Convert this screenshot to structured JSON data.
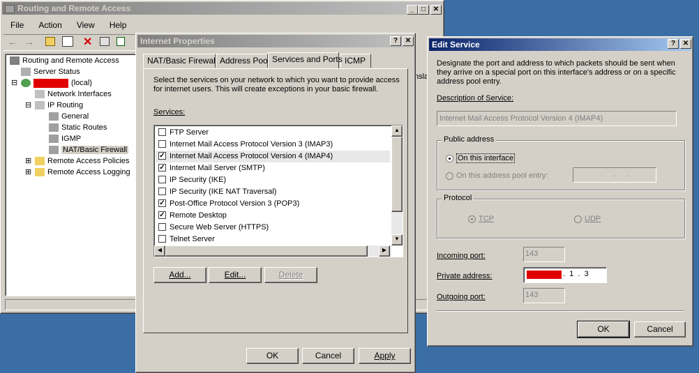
{
  "rra": {
    "title": "Routing and Remote Access",
    "menu": [
      "File",
      "Action",
      "View",
      "Help"
    ],
    "tree": [
      {
        "label": "Routing and Remote Access",
        "icon": "server-tree-root-icon"
      },
      {
        "label": "Server Status",
        "icon": "server-status-icon"
      },
      {
        "label": "(local)",
        "icon": "server-icon"
      },
      {
        "label": "Network Interfaces",
        "icon": "network-interfaces-icon"
      },
      {
        "label": "IP Routing",
        "icon": "ip-routing-icon"
      },
      {
        "label": "General",
        "icon": "general-icon"
      },
      {
        "label": "Static Routes",
        "icon": "static-routes-icon"
      },
      {
        "label": "IGMP",
        "icon": "igmp-icon"
      },
      {
        "label": "NAT/Basic Firewall",
        "icon": "nat-firewall-icon"
      },
      {
        "label": "Remote Access Policies",
        "icon": "policies-icon"
      },
      {
        "label": "Remote Access Logging",
        "icon": "folder-icon"
      }
    ],
    "partial_header": "nsla"
  },
  "props": {
    "title": "Internet Properties",
    "tabs": [
      "NAT/Basic Firewall",
      "Address Pool",
      "Services and Ports",
      "ICMP"
    ],
    "selected_tab": 2,
    "description": "Select the services on your network to which you want to provide access for internet users.  This will create exceptions in your basic firewall.",
    "services_label": "Services:",
    "services": [
      {
        "label": "FTP Server",
        "checked": false
      },
      {
        "label": "Internet Mail Access Protocol Version 3 (IMAP3)",
        "checked": false
      },
      {
        "label": "Internet Mail Access Protocol Version 4 (IMAP4)",
        "checked": true
      },
      {
        "label": "Internet Mail Server (SMTP)",
        "checked": true
      },
      {
        "label": "IP Security (IKE)",
        "checked": false
      },
      {
        "label": "IP Security (IKE NAT Traversal)",
        "checked": false
      },
      {
        "label": "Post-Office Protocol Version 3 (POP3)",
        "checked": true
      },
      {
        "label": "Remote Desktop",
        "checked": true
      },
      {
        "label": "Secure Web Server (HTTPS)",
        "checked": false
      },
      {
        "label": "Telnet Server",
        "checked": false
      }
    ],
    "add_label": "Add...",
    "edit_label": "Edit...",
    "delete_label": "Delete",
    "ok_label": "OK",
    "cancel_label": "Cancel",
    "apply_label": "Apply"
  },
  "edit": {
    "title": "Edit Service",
    "description": "Designate the port and address to which packets should be sent when they arrive on a special port on this interface's address or on a specific address pool entry.",
    "desc_label": "Description of Service:",
    "desc_value": "Internet Mail Access Protocol Version 4 (IMAP4)",
    "public_group": "Public address",
    "on_interface": "On this interface",
    "on_pool": "On this address pool entry:",
    "pool_value": ".     .     .",
    "protocol_group": "Protocol",
    "tcp": "TCP",
    "udp": "UDP",
    "incoming_label": "Incoming port:",
    "incoming_value": "143",
    "private_label": "Private address:",
    "private_value": ".  1  .  3",
    "outgoing_label": "Outgoing port:",
    "outgoing_value": "143",
    "ok_label": "OK",
    "cancel_label": "Cancel"
  }
}
